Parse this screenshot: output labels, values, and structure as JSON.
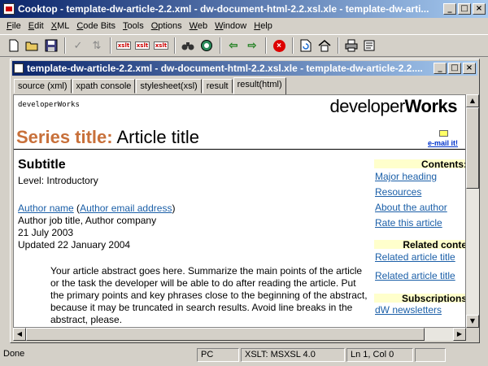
{
  "app": {
    "title": "Cooktop - template-dw-article-2.2.xml - dw-document-html-2.2.xsl.xle - template-dw-arti..."
  },
  "window_buttons": {
    "minimize": "_",
    "maximize": "□",
    "close": "×"
  },
  "menu": [
    "File",
    "Edit",
    "XML",
    "Code Bits",
    "Tools",
    "Options",
    "Web",
    "Window",
    "Help"
  ],
  "toolbar_icons": [
    "new-icon",
    "open-icon",
    "save-icon",
    "check-icon",
    "sort-icon",
    "xslt-icon",
    "xslt-run-icon",
    "xslt-debug-icon",
    "binoculars-icon",
    "globe-icon",
    "arrow-left-icon",
    "arrow-right-icon",
    "stop-icon",
    "refresh-icon",
    "home-icon",
    "print-icon",
    "properties-icon"
  ],
  "toolbar_labels": {
    "xslt": "xslt"
  },
  "child": {
    "title": "template-dw-article-2.2.xml - dw-document-html-2.2.xsl.xle - template-dw-article-2.2....",
    "tabs": [
      "source (xml)",
      "xpath console",
      "stylesheet(xsl)",
      "result",
      "result(html)"
    ],
    "active_tab": "result(html)"
  },
  "doc": {
    "dw_small": "developerWorks",
    "logo_light": "developer",
    "logo_bold": "Works",
    "series_title": "Series title:",
    "article_title": " Article title",
    "email_it": "e-mail it!",
    "subtitle": "Subtitle",
    "level": "Level: Introductory",
    "author_name": "Author name",
    "author_email": "Author email address",
    "author_job": "Author job title, Author company",
    "date": "21 July 2003",
    "updated": "Updated 22 January 2004",
    "abstract": "Your article abstract goes here. Summarize the main points of the article or the task the developer will be able to do after reading the article. Put the primary points and key phrases close to the beginning of the abstract, because it may be truncated in search results. Avoid line breaks in the abstract, please.",
    "sidebar": {
      "contents_head": "Contents:",
      "contents": [
        "Major heading",
        "Resources",
        "About the author",
        "Rate this article"
      ],
      "related_head": "Related conte",
      "related": [
        "Related article title",
        "Related article title"
      ],
      "subs_head": "Subscriptions",
      "subs": [
        "dW newsletters"
      ]
    }
  },
  "status": {
    "msg": "Done",
    "mode": "PC",
    "xslt": "XSLT: MSXSL 4.0",
    "pos": "Ln 1, Col 0"
  }
}
